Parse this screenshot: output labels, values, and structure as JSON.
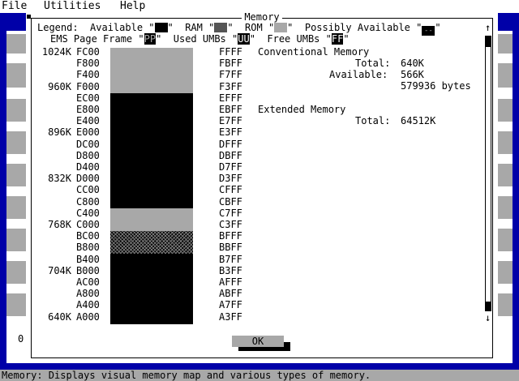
{
  "menu": {
    "items": [
      "File",
      "Utilities",
      "Help"
    ]
  },
  "dialog": {
    "title": "Memory",
    "legend": {
      "label": "Legend:",
      "available": "Available",
      "ram": "RAM",
      "rom": "ROM",
      "possibly_available": "Possibly Available",
      "ems_page_frame": "EMS Page Frame",
      "ems_code": "PP",
      "used_umbs": "Used UMBs",
      "used_code": "UU",
      "free_umbs": "Free UMBs",
      "free_code": "FF"
    },
    "map_rows": [
      {
        "k": "1024K",
        "start": "FC00",
        "end": "FFFF"
      },
      {
        "k": "",
        "start": "F800",
        "end": "FBFF"
      },
      {
        "k": "",
        "start": "F400",
        "end": "F7FF"
      },
      {
        "k": "960K",
        "start": "F000",
        "end": "F3FF"
      },
      {
        "k": "",
        "start": "EC00",
        "end": "EFFF"
      },
      {
        "k": "",
        "start": "E800",
        "end": "EBFF"
      },
      {
        "k": "",
        "start": "E400",
        "end": "E7FF"
      },
      {
        "k": "896K",
        "start": "E000",
        "end": "E3FF"
      },
      {
        "k": "",
        "start": "DC00",
        "end": "DFFF"
      },
      {
        "k": "",
        "start": "D800",
        "end": "DBFF"
      },
      {
        "k": "",
        "start": "D400",
        "end": "D7FF"
      },
      {
        "k": "832K",
        "start": "D000",
        "end": "D3FF"
      },
      {
        "k": "",
        "start": "CC00",
        "end": "CFFF"
      },
      {
        "k": "",
        "start": "C800",
        "end": "CBFF"
      },
      {
        "k": "",
        "start": "C400",
        "end": "C7FF"
      },
      {
        "k": "768K",
        "start": "C000",
        "end": "C3FF"
      },
      {
        "k": "",
        "start": "BC00",
        "end": "BFFF"
      },
      {
        "k": "",
        "start": "B800",
        "end": "BBFF"
      },
      {
        "k": "",
        "start": "B400",
        "end": "B7FF"
      },
      {
        "k": "704K",
        "start": "B000",
        "end": "B3FF"
      },
      {
        "k": "",
        "start": "AC00",
        "end": "AFFF"
      },
      {
        "k": "",
        "start": "A800",
        "end": "ABFF"
      },
      {
        "k": "",
        "start": "A400",
        "end": "A7FF"
      },
      {
        "k": "640K",
        "start": "A000",
        "end": "A3FF"
      }
    ],
    "conventional": {
      "heading": "Conventional Memory",
      "total_label": "Total:",
      "total_value": "640K",
      "available_label": "Available:",
      "available_value": "566K",
      "bytes": "579936 bytes"
    },
    "extended": {
      "heading": "Extended Memory",
      "total_label": "Total:",
      "total_value": "64512K"
    },
    "ok_label": "OK"
  },
  "status": "Memory: Displays visual memory map and various types of memory.",
  "bg_window_char": "0",
  "colors": {
    "desktop": "#0000a8",
    "rom": "#a8a8a8",
    "available": "#000000"
  }
}
